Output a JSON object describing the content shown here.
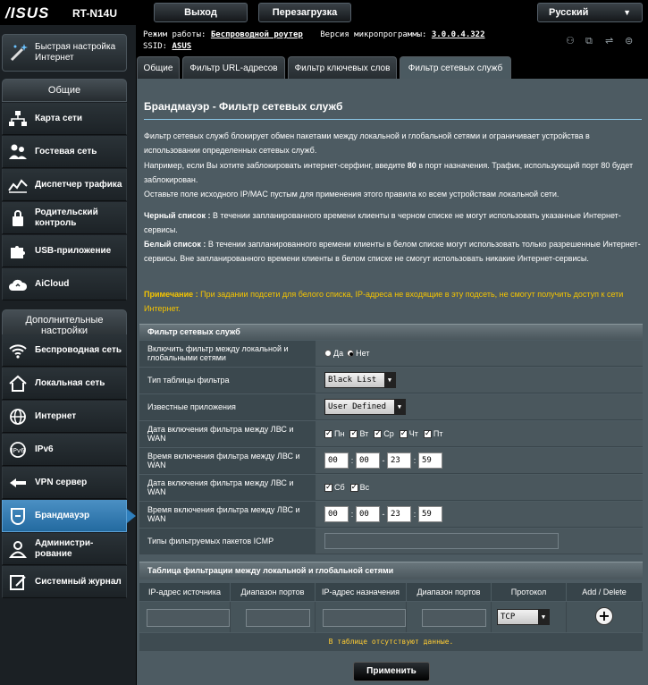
{
  "header": {
    "brand": "/ISUS",
    "model": "RT-N14U",
    "logout_label": "Выход",
    "reboot_label": "Перезагрузка",
    "language": "Русский"
  },
  "info": {
    "mode_label": "Режим работы:",
    "mode_value": "Беспроводной роутер",
    "fw_label": "Версия микропрограммы:",
    "fw_value": "3.0.0.4.322",
    "ssid_label": "SSID:",
    "ssid_value": "ASUS"
  },
  "sidebar": {
    "quick_setup": "Быстрая настройка Интернет",
    "general_header": "Общие",
    "general_items": [
      {
        "label": "Карта сети",
        "icon": "network-map-icon"
      },
      {
        "label": "Гостевая сеть",
        "icon": "guest-network-icon"
      },
      {
        "label": "Диспетчер трафика",
        "icon": "traffic-manager-icon"
      },
      {
        "label": "Родительский контроль",
        "icon": "parental-control-icon"
      },
      {
        "label": "USB-приложение",
        "icon": "usb-app-icon"
      },
      {
        "label": "AiCloud",
        "icon": "aicloud-icon"
      }
    ],
    "advanced_header": "Дополнительные настройки",
    "advanced_items": [
      {
        "label": "Беспроводная сеть",
        "icon": "wireless-icon"
      },
      {
        "label": "Локальная сеть",
        "icon": "lan-icon"
      },
      {
        "label": "Интернет",
        "icon": "wan-icon"
      },
      {
        "label": "IPv6",
        "icon": "ipv6-icon"
      },
      {
        "label": "VPN сервер",
        "icon": "vpn-icon"
      },
      {
        "label": "Брандмауэр",
        "icon": "firewall-icon"
      },
      {
        "label": "Администри-рование",
        "icon": "admin-icon"
      },
      {
        "label": "Системный журнал",
        "icon": "syslog-icon"
      }
    ]
  },
  "tabs": [
    "Общие",
    "Фильтр URL-адресов",
    "Фильтр ключевых слов",
    "Фильтр сетевых служб"
  ],
  "page": {
    "title": "Брандмауэр - Фильтр сетевых служб",
    "p1": "Фильтр сетевых служб блокирует обмен пакетами между локальной и глобальной сетями и ограничивает устройства в использовании определенных сетевых служб.",
    "p2a": "Например, если Вы хотите заблокировать интернет-серфинг, введите",
    "p2b": "80",
    "p2c": "в порт назначения. Трафик, использующий порт 80 будет заблокирован.",
    "p3": "Оставьте поле исходного IP/MAC пустым для применения этого правила ко всем устройствам локальной сети.",
    "black_label": "Черный список :",
    "black_text": "В течении запланированного времени клиенты в черном списке не могут использовать указанные Интернет-сервисы.",
    "white_label": "Белый список :",
    "white_text": "В течении запланированного времени клиенты в белом списке могут использовать только разрешенные Интернет-сервисы. Вне запланированного времени клиенты в белом списке не смогут использовать никакие Интернет-сервисы.",
    "note_label": "Примечание :",
    "note_text": "При задании подсети для белого списка, IP-адреса не входящие в эту подсеть, не смогут получить доступ к сети Интернет."
  },
  "filter": {
    "header": "Фильтр сетевых служб",
    "enable_label": "Включить фильтр между локальной и глобальными сетями",
    "yes": "Да",
    "no": "Нет",
    "table_type_label": "Тип таблицы фильтра",
    "table_type_value": "Black List",
    "apps_label": "Известные приложения",
    "apps_value": "User Defined",
    "date1_label": "Дата включения фильтра между ЛВС и WAN",
    "weekdays": [
      "Пн",
      "Вт",
      "Ср",
      "Чт",
      "Пт"
    ],
    "time1_label": "Время включения фильтра между ЛВС и WAN",
    "time1": [
      "00",
      "00",
      "23",
      "59"
    ],
    "date2_label": "Дата включения фильтра между ЛВС и WAN",
    "weekend": [
      "Сб",
      "Вс"
    ],
    "time2_label": "Время включения фильтра между ЛВС и WAN",
    "time2": [
      "00",
      "00",
      "23",
      "59"
    ],
    "icmp_label": "Типы фильтруемых пакетов ICMP"
  },
  "rules": {
    "header": "Таблица фильтрации между локальной и глобальной сетями",
    "columns": [
      "IP-адрес источника",
      "Диапазон портов",
      "IP-адрес назначения",
      "Диапазон портов",
      "Протокол",
      "Add / Delete"
    ],
    "protocol_value": "TCP",
    "empty_text": "В таблице отсутствуют данные."
  },
  "apply_label": "Применить"
}
